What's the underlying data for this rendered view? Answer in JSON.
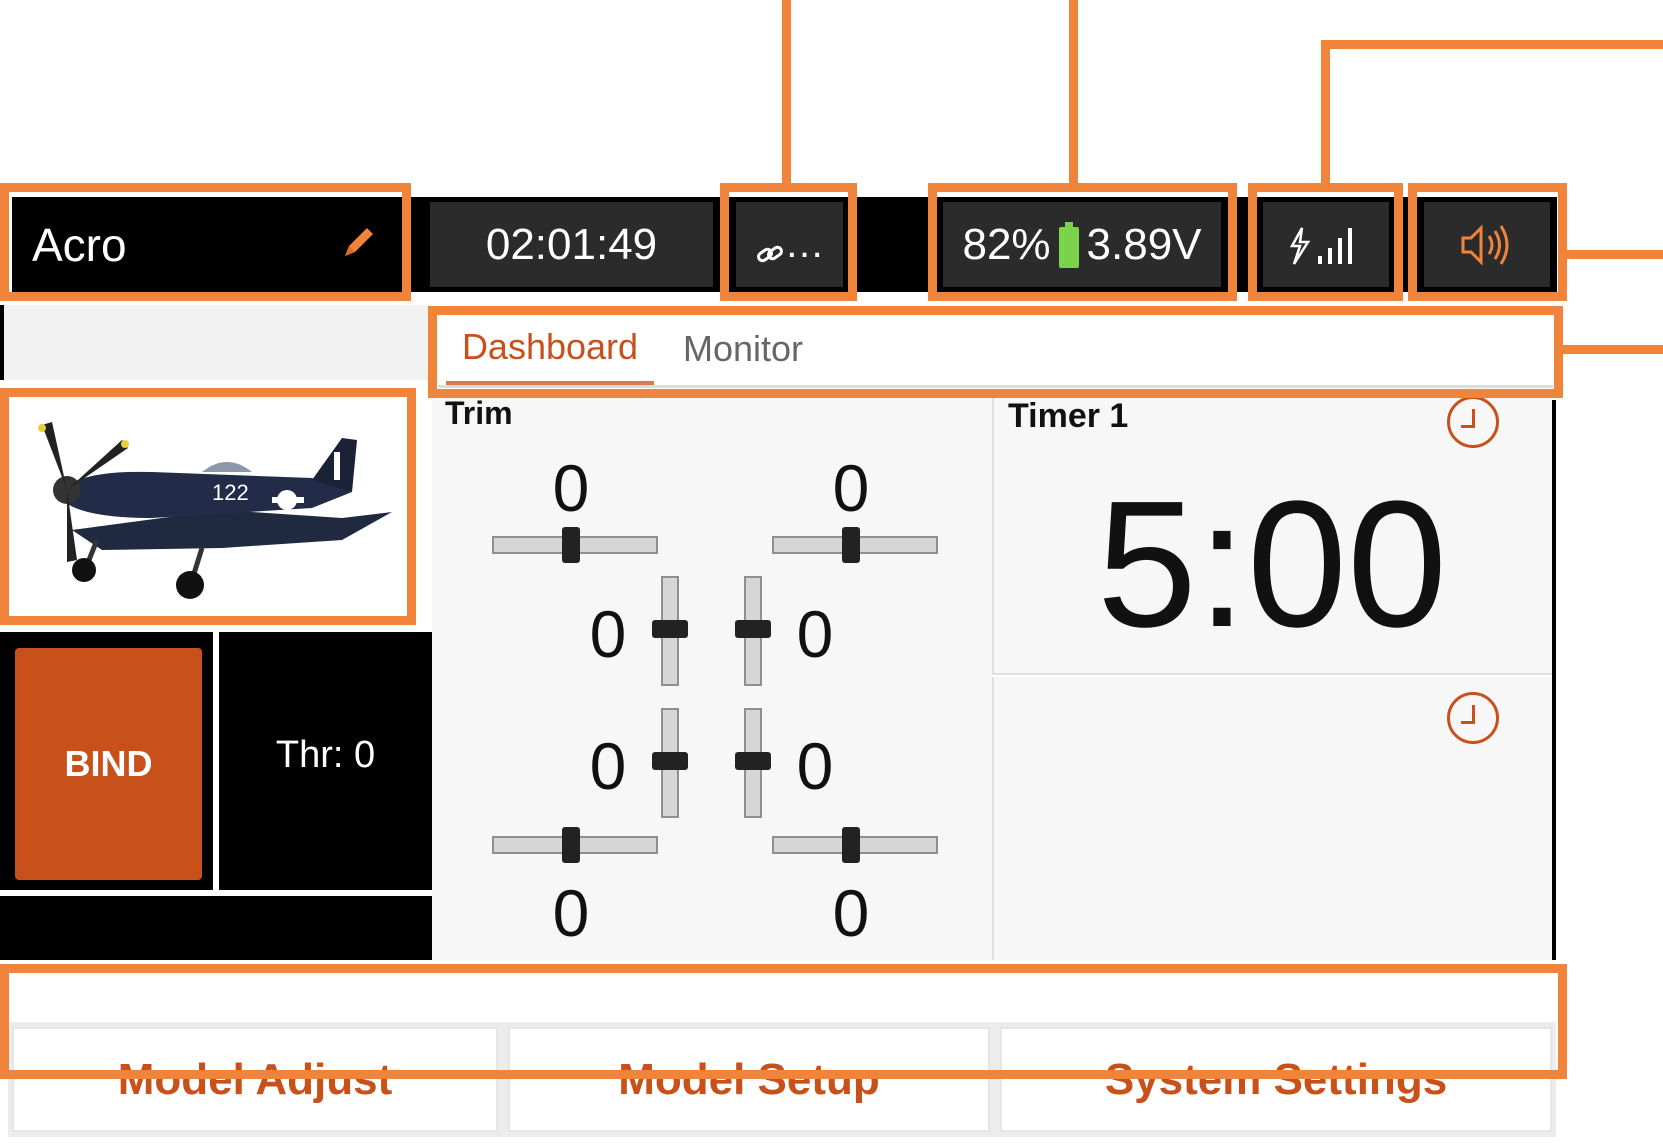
{
  "status_bar": {
    "model_name": "Acro",
    "elapsed_time": "02:01:49",
    "link_text": "…",
    "battery_percent": "82%",
    "battery_voltage": "3.89V"
  },
  "tabs": [
    {
      "label": "Dashboard",
      "active": true
    },
    {
      "label": "Monitor",
      "active": false
    }
  ],
  "model_panel": {
    "bind_label": "BIND",
    "throttle_text": "Thr: 0"
  },
  "trim": {
    "title": "Trim",
    "top_left": "0",
    "top_right": "0",
    "mid_left": "0",
    "mid_right": "0",
    "low_left": "0",
    "low_right": "0",
    "bottom_left": "0",
    "bottom_right": "0"
  },
  "timer": {
    "title": "Timer 1",
    "value": "5:00"
  },
  "bottom_nav": {
    "model_adjust": "Model Adjust",
    "model_setup": "Model Setup",
    "system_settings": "System Settings"
  },
  "colors": {
    "accent": "#f0843a",
    "brand": "#c8501a",
    "battery": "#7ad34a"
  }
}
